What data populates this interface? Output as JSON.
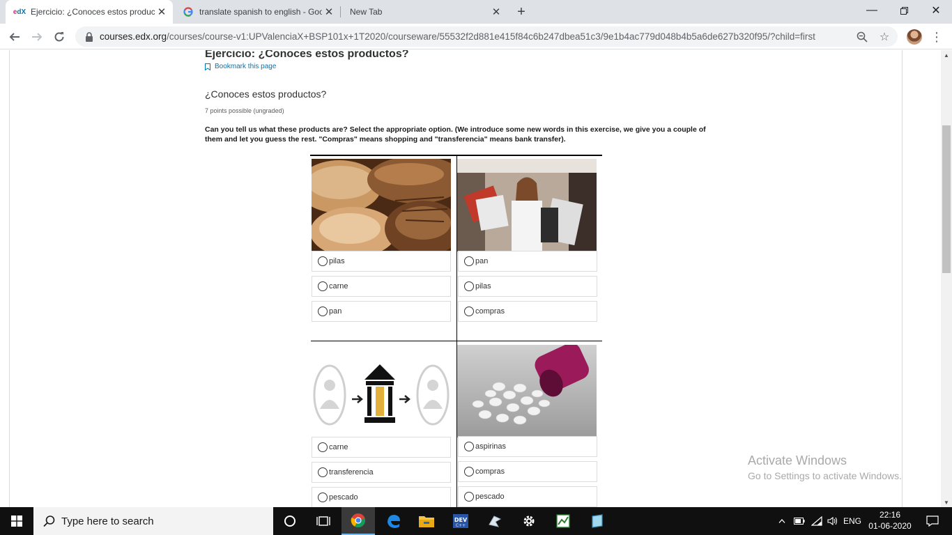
{
  "browser": {
    "tabs": [
      {
        "title": "Ejercicio: ¿Conoces estos product",
        "favicon": "edx-icon"
      },
      {
        "title": "translate spanish to english - Goo",
        "favicon": "google-icon"
      },
      {
        "title": "New Tab",
        "favicon": ""
      }
    ],
    "url": {
      "host": "courses.edx.org",
      "path": "/courses/course-v1:UPValenciaX+BSP101x+1T2020/courseware/55532f2d881e415f84c6b247dbea51c3/9e1b4ac779d048b4b5a6de627b320f95/?child=first"
    }
  },
  "page": {
    "unit_title": "Ejercicio: ¿Conoces estos productos?",
    "bookmark_label": "Bookmark this page",
    "problem_title": "¿Conoces estos productos?",
    "points": "7 points possible (ungraded)",
    "instructions": "Can you tell us what these products are? Select the appropriate option. (We introduce some new words in this exercise, we give you a couple of them and let you guess the rest. \"Compras\" means shopping and \"transferencia\" means bank transfer).",
    "questions": [
      {
        "image": "bread-image",
        "options": [
          "pilas",
          "carne",
          "pan"
        ]
      },
      {
        "image": "shopping-image",
        "options": [
          "pan",
          "pilas",
          "compras"
        ]
      },
      {
        "image": "bank-transfer-image",
        "options": [
          "carne",
          "transferencia",
          "pescado"
        ]
      },
      {
        "image": "pills-image",
        "options": [
          "aspirinas",
          "compras",
          "pescado"
        ]
      }
    ]
  },
  "watermark": {
    "line1": "Activate Windows",
    "line2": "Go to Settings to activate Windows."
  },
  "taskbar": {
    "search_placeholder": "Type here to search",
    "language": "ENG",
    "time": "22:16",
    "date": "01-06-2020"
  },
  "colors": {
    "link": "#0075b4",
    "tabstrip": "#dee1e6",
    "taskbar": "#101010"
  }
}
